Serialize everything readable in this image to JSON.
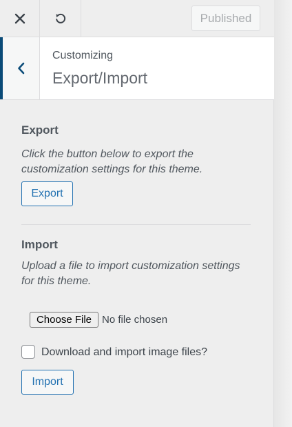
{
  "header": {
    "close_icon": "close-icon",
    "reset_icon": "undo-icon",
    "published_label": "Published"
  },
  "section": {
    "breadcrumb": "Customizing",
    "title": "Export/Import",
    "back_icon": "chevron-left-icon"
  },
  "export": {
    "heading": "Export",
    "description": "Click the button below to export the customization settings for this theme.",
    "button_label": "Export"
  },
  "import": {
    "heading": "Import",
    "description": "Upload a file to import customization settings for this theme.",
    "choose_file_label": "Choose File",
    "file_status": "No file chosen",
    "checkbox_label": "Download and import image files?",
    "checkbox_checked": false,
    "button_label": "Import"
  },
  "colors": {
    "accent": "#2271b1",
    "back_border": "#0a4b78",
    "panel_bg": "#eeeeee"
  }
}
